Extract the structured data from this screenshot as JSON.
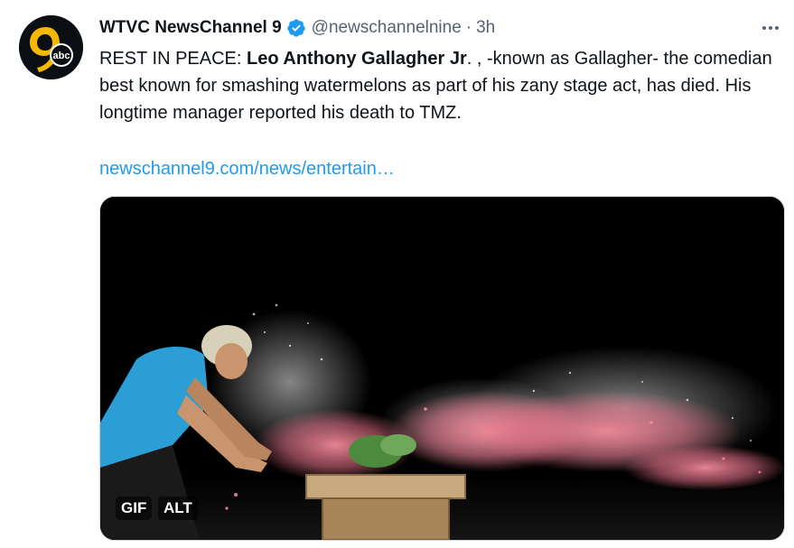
{
  "tweet": {
    "author_name": "WTVC NewsChannel 9",
    "handle": "@newschannelnine",
    "separator": "·",
    "time": "3h",
    "avatar_icon": "wtvc-9-abc-logo",
    "text_prefix": "REST IN PEACE: ",
    "text_bold": "Leo Anthony Gallagher Jr",
    "text_suffix": ". , -known as Gallagher- the comedian best known for smashing watermelons as part of his zany stage act, has died. His longtime manager reported his death to TMZ.",
    "link": "newschannel9.com/news/entertain…",
    "media": {
      "gif_label": "GIF",
      "alt_label": "ALT"
    },
    "colors": {
      "link": "#1d9bf0",
      "verified": "#1d9bf0",
      "secondary_text": "#536471"
    }
  }
}
